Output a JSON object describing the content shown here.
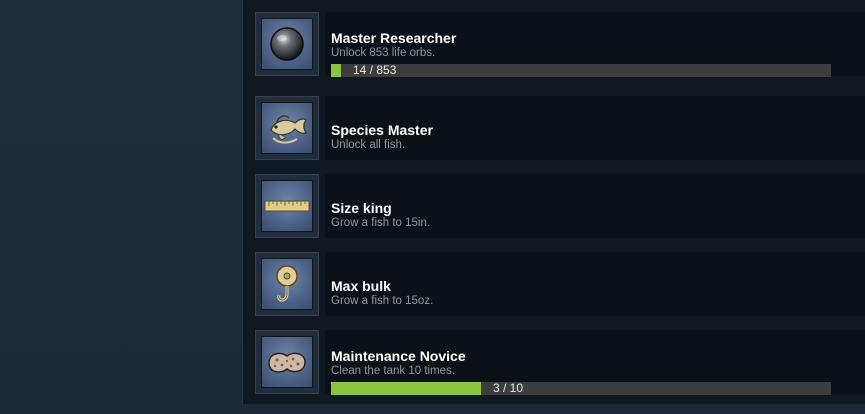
{
  "colors": {
    "page_bg": "#1b2838",
    "row_bg": "#0b1118",
    "progress_fill": "#8bc53f",
    "progress_track": "#3c3d3e",
    "title_text": "#ffffff",
    "desc_text": "#8f98a0"
  },
  "achievements": [
    {
      "icon": "orb-icon",
      "title": "Master Researcher",
      "description": "Unlock 853 life orbs.",
      "progress_text": "14 / 853",
      "progress_fraction": 0.0164
    },
    {
      "icon": "fish-icon",
      "title": "Species Master",
      "description": "Unlock all fish."
    },
    {
      "icon": "ruler-icon",
      "title": "Size king",
      "description": "Grow a fish to 15in."
    },
    {
      "icon": "hook-weight-icon",
      "title": "Max bulk",
      "description": "Grow a fish to 15oz."
    },
    {
      "icon": "sponge-icon",
      "title": "Maintenance Novice",
      "description": "Clean the tank 10 times.",
      "progress_text": "3 / 10",
      "progress_fraction": 0.3
    }
  ]
}
